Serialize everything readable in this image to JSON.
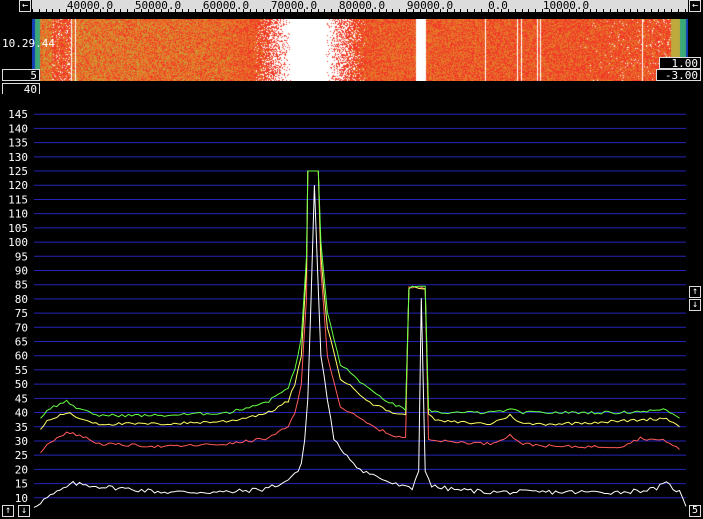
{
  "freq_labels": [
    "40000.0",
    "50000.0",
    "60000.0",
    "70000.0",
    "80000.0",
    "90000.0",
    "0.0",
    "10000.0"
  ],
  "waterfall_time": "10.29.44",
  "left_top_value": "5",
  "left_second_value": "40",
  "right_value_1": "1.00",
  "right_value_2": "-3.00",
  "bottom_right_value": "5",
  "buttons": {
    "arrow_left": "←",
    "arrow_right": "→",
    "arrow_up": "↑",
    "arrow_down": "↓"
  },
  "chart_data": {
    "type": "line",
    "y_ticks": [
      10,
      15,
      20,
      25,
      30,
      35,
      40,
      45,
      50,
      55,
      60,
      65,
      70,
      75,
      80,
      85,
      90,
      95,
      100,
      105,
      110,
      115,
      120,
      125,
      130,
      135,
      140,
      145
    ],
    "ylim": [
      5,
      150
    ],
    "xlim": [
      0,
      1
    ],
    "grid": true,
    "series": [
      {
        "color": "#ffffff",
        "x": [
          0,
          0.02,
          0.06,
          0.1,
          0.2,
          0.3,
          0.35,
          0.38,
          0.4,
          0.41,
          0.415,
          0.42,
          0.425,
          0.43,
          0.44,
          0.46,
          0.5,
          0.55,
          0.58,
          0.59,
          0.594,
          0.6,
          0.61,
          0.64,
          0.7,
          0.75,
          0.9,
          0.95,
          0.97,
          0.99,
          1.0
        ],
        "y": [
          7,
          10,
          15,
          14,
          12,
          12,
          13,
          15,
          18,
          22,
          30,
          45,
          80,
          120,
          60,
          30,
          20,
          15,
          13,
          20,
          80,
          20,
          14,
          13,
          12,
          12,
          12,
          13,
          15,
          12,
          7
        ]
      },
      {
        "color": "#ff5a5a",
        "x": [
          0.01,
          0.02,
          0.05,
          0.07,
          0.1,
          0.2,
          0.3,
          0.36,
          0.39,
          0.4,
          0.41,
          0.418,
          0.42,
          0.436,
          0.44,
          0.45,
          0.47,
          0.52,
          0.55,
          0.57,
          0.575,
          0.6,
          0.605,
          0.62,
          0.7,
          0.73,
          0.75,
          0.8,
          0.9,
          0.93,
          0.97,
          0.99
        ],
        "y": [
          26,
          29,
          33,
          32,
          29,
          28,
          29,
          31,
          35,
          40,
          50,
          80,
          125,
          125,
          90,
          60,
          42,
          35,
          32,
          31,
          84,
          84,
          31,
          30,
          29,
          32,
          29,
          28,
          28,
          31,
          30,
          27
        ]
      },
      {
        "color": "#ffff66",
        "x": [
          0.01,
          0.02,
          0.05,
          0.07,
          0.1,
          0.2,
          0.3,
          0.36,
          0.39,
          0.4,
          0.41,
          0.418,
          0.42,
          0.436,
          0.44,
          0.45,
          0.47,
          0.52,
          0.55,
          0.57,
          0.575,
          0.6,
          0.605,
          0.62,
          0.7,
          0.73,
          0.75,
          0.8,
          0.9,
          0.97,
          0.99
        ],
        "y": [
          34,
          37,
          40,
          38,
          36,
          36,
          37,
          40,
          44,
          50,
          60,
          90,
          125,
          125,
          95,
          70,
          52,
          43,
          40,
          39,
          84,
          84,
          39,
          37,
          36,
          39,
          36,
          36,
          37,
          38,
          35
        ]
      },
      {
        "color": "#66ff44",
        "x": [
          0.01,
          0.02,
          0.05,
          0.07,
          0.1,
          0.2,
          0.3,
          0.36,
          0.39,
          0.4,
          0.41,
          0.418,
          0.42,
          0.436,
          0.44,
          0.45,
          0.47,
          0.52,
          0.55,
          0.57,
          0.575,
          0.6,
          0.605,
          0.62,
          0.7,
          0.73,
          0.75,
          0.8,
          0.9,
          0.97,
          0.99
        ],
        "y": [
          38,
          41,
          44,
          41,
          39,
          39,
          40,
          44,
          49,
          55,
          66,
          95,
          125,
          125,
          100,
          75,
          57,
          47,
          43,
          41,
          84,
          84,
          41,
          40,
          40,
          41,
          40,
          40,
          40,
          41,
          38
        ]
      }
    ]
  }
}
